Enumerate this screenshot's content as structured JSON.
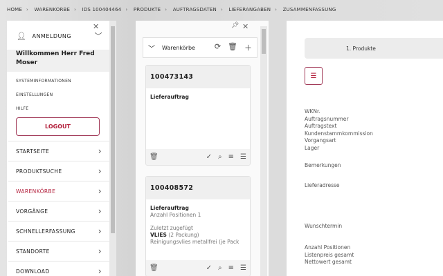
{
  "breadcrumb": [
    "HOME",
    "WARENKORBE",
    "IDS 100404464",
    "PRODUKTE",
    "AUFTRAGSDATEN",
    "LIEFERANGABEN",
    "ZUSAMMENFASSUNG"
  ],
  "left": {
    "user_label": "ANMELDUNG",
    "welcome": "Willkommen Herr Fred Moser",
    "links": [
      "SYSTEMINFORMATIONEN",
      "EINSTELLUNGEN",
      "HILFE"
    ],
    "logout": "LOGOUT",
    "nav": [
      "STARTSEITE",
      "PRODUKTSUCHE",
      "WARENKÖRBE",
      "VORGÄNGE",
      "SCHNELLERFASSUNG",
      "STANDORTE",
      "DOWNLOAD"
    ],
    "active": "WARENKÖRBE"
  },
  "mid": {
    "title": "Warenkörbe",
    "cards": [
      {
        "number": "100473143",
        "type": "Lieferauftrag"
      },
      {
        "number": "100408572",
        "type": "Lieferauftrag",
        "positions": "Anzahl Positionen 1",
        "last_added": "Zuletzt zugefügt",
        "product": "VLIES",
        "qty": "(2 Packung)",
        "desc": "Reinigungsvlies metallfrei (je Pack"
      }
    ]
  },
  "right": {
    "step": "1. Produkte",
    "labels_a": [
      "WKNr.",
      "Auftragsnummer",
      "Auftragstext",
      "Kundenstammkommission",
      "Vorgangsart",
      "Lager"
    ],
    "remarks": "Bemerkungen",
    "address": "Lieferadresse",
    "date": "Wunschtermin",
    "labels_b": [
      "Anzahl Positionen",
      "Listenpreis gesamt",
      "Nettowert gesamt"
    ]
  },
  "colors": {
    "accent": "#b3203c"
  }
}
